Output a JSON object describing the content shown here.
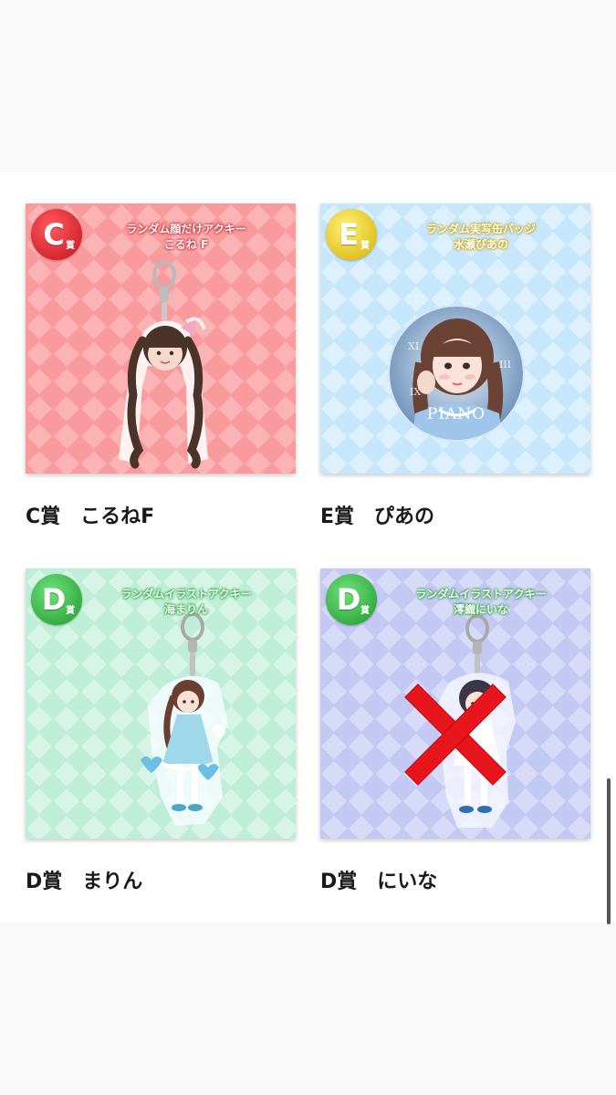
{
  "cards": [
    {
      "badge_letter": "C",
      "badge_sub": "賞",
      "title_line1": "ランダム顔だけアクキー",
      "title_line2": "こるね F",
      "caption": "C賞　こるねF",
      "bg_color": "#f99a9c",
      "badge_color": "#d9252f",
      "item_type": "acrylic-keychain-face"
    },
    {
      "badge_letter": "E",
      "badge_sub": "賞",
      "title_line1": "ランダム実写缶バッジ",
      "title_line2": "水瀬ぴあの",
      "caption": "E賞　ぴあの",
      "bg_color": "#c6e6fb",
      "badge_color": "#f1d11a",
      "item_type": "can-badge",
      "badge_print": "PIANO"
    },
    {
      "badge_letter": "D",
      "badge_sub": "賞",
      "title_line1": "ランダムイラストアクキー",
      "title_line2": "海まりん",
      "caption": "D賞　まりん",
      "bg_color": "#bfeed8",
      "badge_color": "#32b93e",
      "item_type": "acrylic-keychain-illust"
    },
    {
      "badge_letter": "D",
      "badge_sub": "賞",
      "title_line1": "ランダムイラストアクキー",
      "title_line2": "澪織にいな",
      "caption": "D賞　にいな",
      "bg_color": "#c4c9f3",
      "badge_color": "#32b93e",
      "item_type": "acrylic-keychain-illust",
      "crossed_out": true,
      "cross_color": "#e8151c"
    }
  ]
}
